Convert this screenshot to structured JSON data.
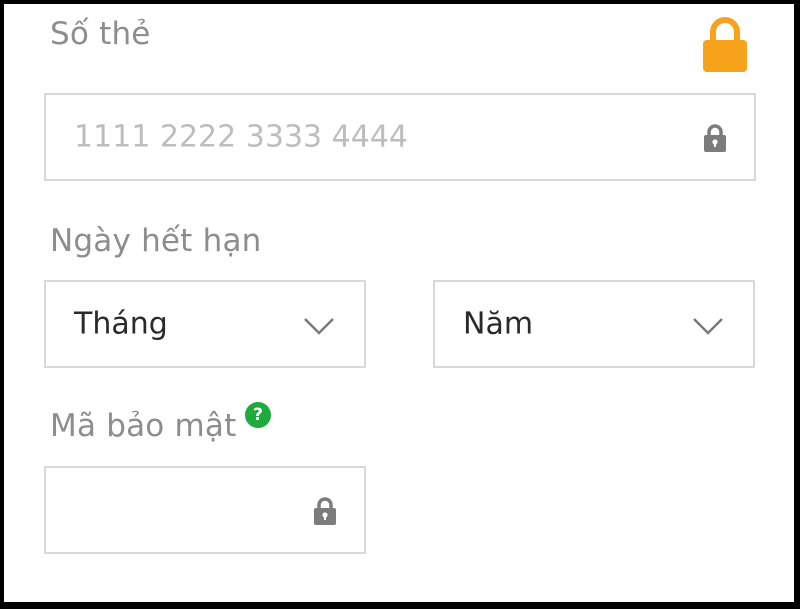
{
  "card_number": {
    "label": "Số thẻ",
    "placeholder": "1111 2222 3333 4444",
    "secure_icon": "lock-icon",
    "field_icon": "lock-icon",
    "accent_color": "#f7a21b"
  },
  "expiry": {
    "label": "Ngày hết hạn",
    "month_select": {
      "value": "Tháng",
      "icon": "chevron-down-icon"
    },
    "year_select": {
      "value": "Năm",
      "icon": "chevron-down-icon"
    }
  },
  "security_code": {
    "label": "Mã bảo mật",
    "help_icon": "help-icon",
    "help_glyph": "?",
    "help_color": "#1faa3d",
    "field_icon": "lock-icon"
  }
}
